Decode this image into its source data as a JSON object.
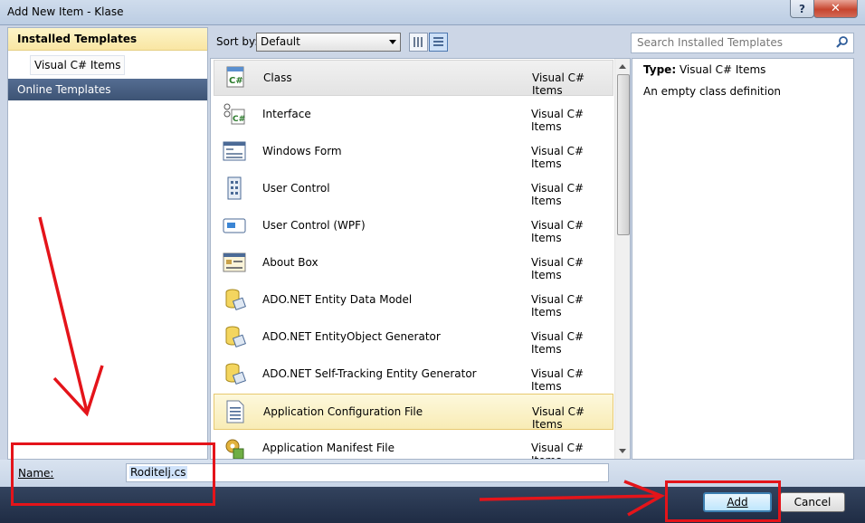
{
  "window": {
    "title": "Add New Item - Klase",
    "help": "?",
    "close": "✕"
  },
  "left": {
    "installed": "Installed Templates",
    "visual_cs": "Visual C# Items",
    "online": "Online Templates"
  },
  "toolbar": {
    "sort_label": "Sort by:",
    "sort_value": "Default"
  },
  "search": {
    "placeholder": "Search Installed Templates"
  },
  "items": [
    {
      "name": "Class",
      "category": "Visual C# Items",
      "icon": "class-icon"
    },
    {
      "name": "Interface",
      "category": "Visual C# Items",
      "icon": "interface-icon"
    },
    {
      "name": "Windows Form",
      "category": "Visual C# Items",
      "icon": "windows-form-icon"
    },
    {
      "name": "User Control",
      "category": "Visual C# Items",
      "icon": "user-control-icon"
    },
    {
      "name": "User Control (WPF)",
      "category": "Visual C# Items",
      "icon": "user-control-wpf-icon"
    },
    {
      "name": "About Box",
      "category": "Visual C# Items",
      "icon": "about-box-icon"
    },
    {
      "name": "ADO.NET Entity Data Model",
      "category": "Visual C# Items",
      "icon": "entity-data-model-icon"
    },
    {
      "name": "ADO.NET EntityObject Generator",
      "category": "Visual C# Items",
      "icon": "entity-generator-icon"
    },
    {
      "name": "ADO.NET Self-Tracking Entity Generator",
      "category": "Visual C# Items",
      "icon": "self-tracking-generator-icon"
    },
    {
      "name": "Application Configuration File",
      "category": "Visual C# Items",
      "icon": "config-file-icon"
    },
    {
      "name": "Application Manifest File",
      "category": "Visual C# Items",
      "icon": "manifest-file-icon"
    }
  ],
  "details": {
    "type_label": "Type:",
    "type_value": "Visual C# Items",
    "description": "An empty class definition"
  },
  "form": {
    "name_label": "Name:",
    "name_value": "Roditelj.cs"
  },
  "buttons": {
    "add": "Add",
    "cancel": "Cancel"
  },
  "colors": {
    "annotation": "#e4141a",
    "footer": "#27364f",
    "selection": "#f8ecb6"
  }
}
